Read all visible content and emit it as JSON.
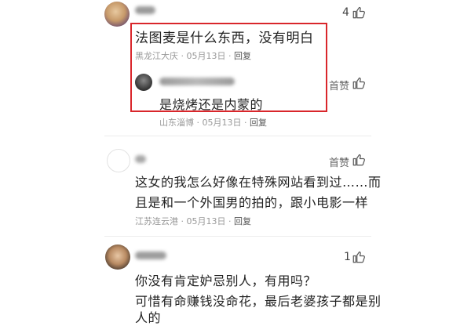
{
  "comments": [
    {
      "likes": "4",
      "text": "法图麦是什么东西，没有明白",
      "meta": {
        "location": "黑龙江大庆",
        "date": "05月13日",
        "reply": "回复",
        "sep": "·"
      },
      "reply": {
        "likes": "首赞",
        "text": "是烧烤还是内蒙的"
      },
      "meta_after_reply": {
        "location": "山东淄博",
        "date": "05月13日",
        "reply": "回复",
        "sep": "·"
      }
    },
    {
      "likes": "首赞",
      "text_line1": "这女的我怎么好像在特殊网站看到过……而",
      "text_line2": "且是和一个外国男的拍的，跟小电影一样",
      "meta": {
        "location": "江苏连云港",
        "date": "05月13日",
        "reply": "回复",
        "sep": "·"
      }
    },
    {
      "likes": "1",
      "text_line1": "你没有肯定妒忌别人，有用吗？",
      "text_line2": "可惜有命赚钱没命花，最后老婆孩子都是别",
      "text_line3": "人的"
    }
  ],
  "colors": {
    "highlight": "#d9262b",
    "meta": "#999999"
  },
  "icons": {
    "like": "thumbs-up-icon"
  }
}
